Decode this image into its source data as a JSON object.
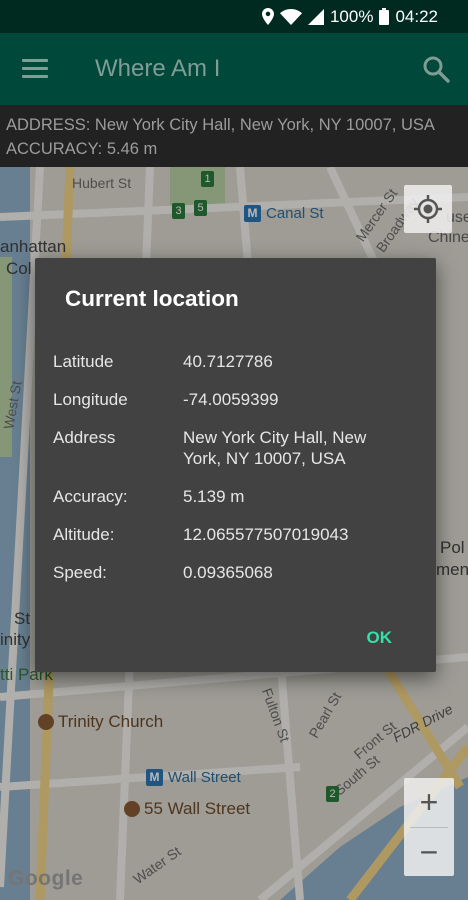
{
  "status_bar": {
    "battery": "100%",
    "time": "04:22",
    "icons": [
      "location-icon",
      "wifi-icon",
      "signal-icon",
      "battery-icon"
    ]
  },
  "app_bar": {
    "title": "Where Am I",
    "menu_icon": "menu-icon",
    "search_icon": "search-icon"
  },
  "info": {
    "address": "ADDRESS: New York City Hall, New York, NY 10007, USA",
    "accuracy": "ACCURACY: 5.46 m"
  },
  "map": {
    "streets": [
      "Hubert St",
      "Canal St",
      "West St",
      "Mercer St",
      "Broadway",
      "Fulton St",
      "Pearl St",
      "Front St",
      "South St",
      "FDR Drive",
      "Water St"
    ],
    "place_fragments": [
      "anhattan",
      "Col",
      "use",
      "Chine",
      "St",
      "inity",
      "tti Park",
      "Pol",
      "ment"
    ],
    "places": [
      "Trinity Church",
      "55 Wall Street"
    ],
    "metro": [
      "Canal St",
      "Wall Street"
    ],
    "metro_letter": "M",
    "route_badges": [
      "1",
      "3",
      "5",
      "2"
    ],
    "zoom_in": "+",
    "zoom_out": "−",
    "logo": "Google"
  },
  "dialog": {
    "title": "Current location",
    "rows": [
      {
        "label": "Latitude",
        "value": "40.7127786"
      },
      {
        "label": "Longitude",
        "value": "-74.0059399"
      },
      {
        "label": "Address",
        "value": "New York City Hall, New York, NY 10007, USA"
      },
      {
        "label": "Accuracy:",
        "value": "5.139 m"
      },
      {
        "label": "Altitude:",
        "value": "12.065577507019043"
      },
      {
        "label": "Speed:",
        "value": "0.09365068"
      }
    ],
    "ok": "OK"
  },
  "colors": {
    "status_bar": "#002a20",
    "app_bar": "#00483a",
    "dialog_bg": "#424242",
    "accent": "#33e0a8"
  }
}
